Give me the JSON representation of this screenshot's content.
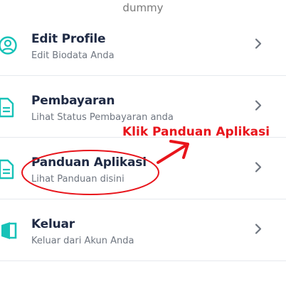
{
  "profile": {
    "username": "dummy"
  },
  "menu": {
    "items": [
      {
        "title": "Edit Profile",
        "subtitle": "Edit Biodata Anda",
        "icon": "user-circle-icon"
      },
      {
        "title": "Pembayaran",
        "subtitle": "Lihat Status Pembayaran anda",
        "icon": "document-icon"
      },
      {
        "title": "Panduan Aplikasi",
        "subtitle": "Lihat Panduan disini",
        "icon": "document-icon"
      },
      {
        "title": "Keluar",
        "subtitle": "Keluar dari Akun Anda",
        "icon": "exit-door-icon"
      }
    ]
  },
  "annotation": {
    "text": "Klik Panduan Aplikasi",
    "color": "#e8141b"
  },
  "colors": {
    "accent": "#17c2b8",
    "title": "#1f2a44",
    "subtitle": "#6f7680",
    "divider": "#e6e9ee"
  }
}
